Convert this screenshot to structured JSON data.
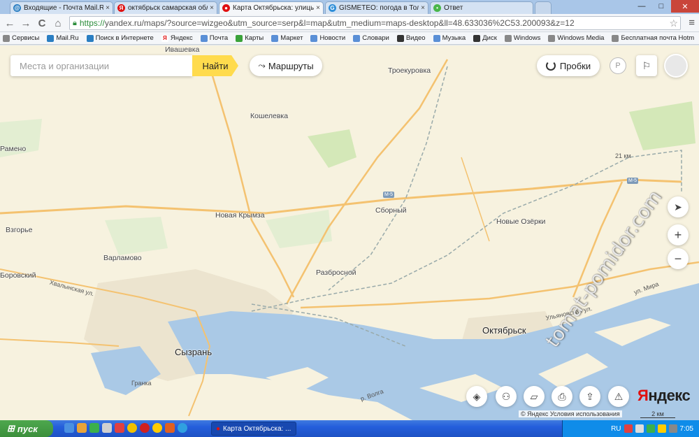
{
  "browser": {
    "tabs": [
      {
        "title": "Входящие - Почта Mail.Ru",
        "icon": "mailru-icon",
        "color": "#2a7ec2",
        "active": false
      },
      {
        "title": "октябрьск самарская обла",
        "icon": "yandex-icon",
        "color": "#e01010",
        "active": false
      },
      {
        "title": "Карта Октябрьска: улицы,",
        "icon": "yandex-maps-icon",
        "color": "#e01010",
        "active": true
      },
      {
        "title": "GISMETEO: погода в Толья",
        "icon": "gismeteo-icon",
        "color": "#2e8ed8",
        "active": false
      },
      {
        "title": "Ответ",
        "icon": "answer-icon",
        "color": "#49b64a",
        "active": false
      }
    ],
    "tab_close": "×",
    "window_controls": {
      "minimize": "—",
      "maximize": "□",
      "close": "✕"
    },
    "nav": {
      "back": "←",
      "forward": "→",
      "reload": "C",
      "home": "⌂"
    },
    "url_scheme": "https://",
    "url_rest": "yandex.ru/maps/?source=wizgeo&utm_source=serp&l=map&utm_medium=maps-desktop&ll=48.633036%2C53.200093&z=12",
    "star": "☆",
    "menu": "≡",
    "bookmarks": [
      {
        "label": "Сервисы",
        "color": "#888"
      },
      {
        "label": "Mail.Ru",
        "color": "#2a7ec2"
      },
      {
        "label": "Поиск в Интернете",
        "color": "#2a7ec2"
      },
      {
        "label": "Яндекс",
        "color": "#e01010"
      },
      {
        "label": "Почта",
        "color": "#5a8fd6"
      },
      {
        "label": "Карты",
        "color": "#3aa23a"
      },
      {
        "label": "Маркет",
        "color": "#5a8fd6"
      },
      {
        "label": "Новости",
        "color": "#5a8fd6"
      },
      {
        "label": "Словари",
        "color": "#5a8fd6"
      },
      {
        "label": "Видео",
        "color": "#333"
      },
      {
        "label": "Музыка",
        "color": "#5a8fd6"
      },
      {
        "label": "Диск",
        "color": "#333"
      },
      {
        "label": "Windows",
        "color": "#888"
      },
      {
        "label": "Windows Media",
        "color": "#888"
      },
      {
        "label": "Бесплатная почта Hotm",
        "color": "#888"
      }
    ]
  },
  "map": {
    "search_placeholder": "Места и организации",
    "find_label": "Найти",
    "routes_label": "Маршруты",
    "traffic_label": "Пробки",
    "parking_label": "P",
    "places": [
      {
        "name": "Ивашевка",
        "big": false
      },
      {
        "name": "Троекуровка",
        "big": false
      },
      {
        "name": "Кошелевка",
        "big": false
      },
      {
        "name": "Рамено",
        "big": false
      },
      {
        "name": "Сборный",
        "big": false
      },
      {
        "name": "Новая Крымза",
        "big": false
      },
      {
        "name": "Новые Озёрки",
        "big": false
      },
      {
        "name": "Взгорье",
        "big": false
      },
      {
        "name": "Варламово",
        "big": false
      },
      {
        "name": "Боровский",
        "big": false
      },
      {
        "name": "Разбросной",
        "big": false
      },
      {
        "name": "Октябрьск",
        "big": true
      },
      {
        "name": "Сызрань",
        "big": true
      }
    ],
    "road_labels": {
      "khvalynskaya": "Хвалынская ул.",
      "ulyanovskaya": "Ульяновская ул.",
      "mira": "ул. Мира",
      "volga": "р. Волга",
      "granka": "Гранка",
      "km21": "21 км"
    },
    "shields": [
      "М-5",
      "М-5"
    ],
    "logo_prefix": "Я",
    "logo_rest": "ндекс",
    "copyright": "© Яндекс Условия использования",
    "scale": "2 км",
    "watermark": "tomat-pomidor.com",
    "zoom_in": "+",
    "zoom_out": "−",
    "colors": {
      "land": "#f7f2df",
      "water": "#aac9e6",
      "road": "#f4c270",
      "forest": "#d4e8b8",
      "urban": "#ece4cf"
    }
  },
  "taskbar": {
    "start_label": "пуск",
    "task_title": "Карта Октябрьска: ...",
    "lang": "RU",
    "clock": "7:05"
  }
}
